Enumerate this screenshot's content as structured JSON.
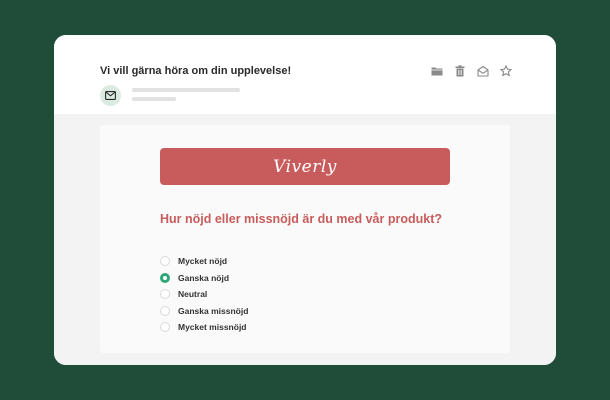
{
  "email": {
    "subject": "Vi vill gärna höra om din upplevelse!",
    "toolbar": [
      {
        "icon": "folder-icon",
        "name": "folder-button"
      },
      {
        "icon": "trash-icon",
        "name": "delete-button"
      },
      {
        "icon": "envelope-open-icon",
        "name": "mark-read-button"
      },
      {
        "icon": "star-icon",
        "name": "star-button"
      }
    ],
    "sender_icon": "envelope-icon"
  },
  "survey": {
    "brand": "Viverly",
    "question": "Hur nöjd eller missnöjd är du med vår produkt?",
    "options": [
      {
        "label": "Mycket nöjd",
        "selected": false
      },
      {
        "label": "Ganska nöjd",
        "selected": true
      },
      {
        "label": "Neutral",
        "selected": false
      },
      {
        "label": "Ganska missnöjd",
        "selected": false
      },
      {
        "label": "Mycket missnöjd",
        "selected": false
      }
    ]
  },
  "colors": {
    "background": "#1f4d3a",
    "brand": "#c85c5c",
    "selected": "#2ea878"
  }
}
